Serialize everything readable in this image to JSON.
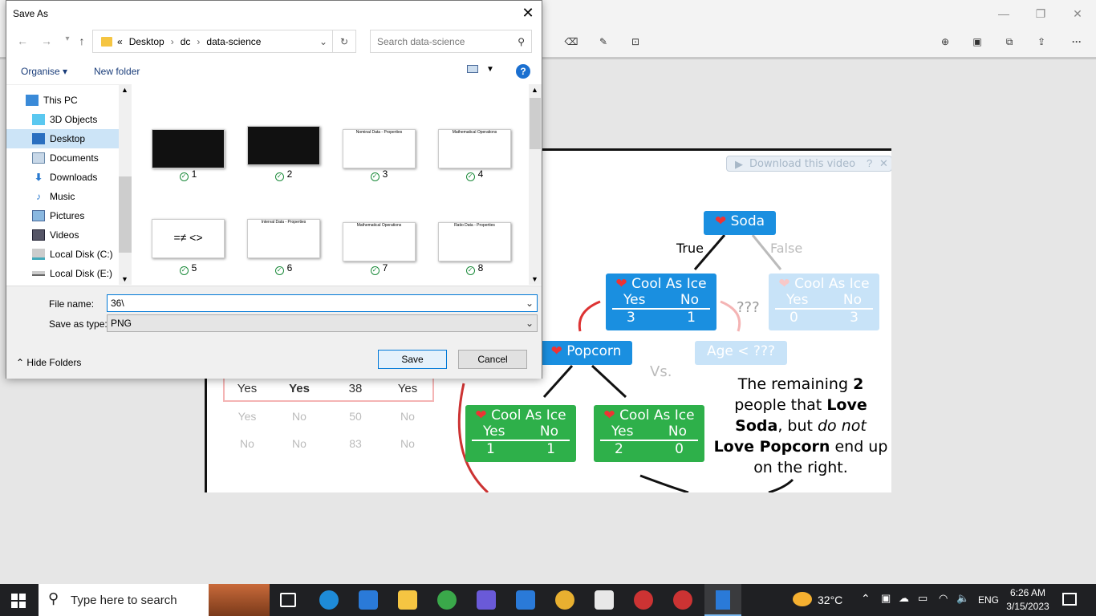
{
  "app": {
    "toolbar_icons": [
      "erase-icon",
      "ruler-icon",
      "crop-icon",
      "zoom-in-icon",
      "save-icon",
      "copy-icon",
      "share-icon",
      "more-icon"
    ]
  },
  "video": {
    "download_label": "Download this video",
    "table_rows": [
      [
        "Yes",
        "Yes",
        "38",
        "Yes"
      ],
      [
        "Yes",
        "No",
        "50",
        "No"
      ],
      [
        "No",
        "No",
        "83",
        "No"
      ]
    ],
    "soda": "Soda",
    "true_label": "True",
    "false_label": "False",
    "cool_as_ice": "Cool As Ice",
    "yes": "Yes",
    "no": "No",
    "left_vals": [
      "3",
      "1"
    ],
    "right_vals": [
      "0",
      "3"
    ],
    "qmarks": "???",
    "popcorn": "Popcorn",
    "age": "Age < ???",
    "vs": "Vs.",
    "bl_vals": [
      "1",
      "1"
    ],
    "br_vals": [
      "2",
      "0"
    ],
    "caption_parts": [
      "The remaining ",
      "2",
      " people that ",
      "Love Soda",
      ", but ",
      "do not",
      "Love Popcorn",
      " end up on the right."
    ]
  },
  "dialog": {
    "title": "Save As",
    "breadcrumb": [
      "«",
      "Desktop",
      "dc",
      "data-science"
    ],
    "search_placeholder": "Search data-science",
    "organise": "Organise",
    "new_folder": "New folder",
    "nav_items": [
      "This PC",
      "3D Objects",
      "Desktop",
      "Documents",
      "Downloads",
      "Music",
      "Pictures",
      "Videos",
      "Local Disk (C:)",
      "Local Disk (E:)"
    ],
    "thumb_headers": [
      "",
      "",
      "Nominal Data - Properties",
      "Mathematical Operations",
      "",
      "Interval Data - Properties",
      "Mathematical Operations",
      "Ratio Data - Properties"
    ],
    "files": [
      "1",
      "2",
      "3",
      "4",
      "5",
      "6",
      "7",
      "8"
    ],
    "file_name_label": "File name:",
    "file_name_value": "36\\",
    "save_type_label": "Save as type:",
    "save_type_value": "PNG",
    "hide_folders": "Hide Folders",
    "save_btn": "Save",
    "cancel_btn": "Cancel"
  },
  "taskbar": {
    "search_placeholder": "Type here to search",
    "temperature": "32°C",
    "language": "ENG",
    "time": "6:26 AM",
    "date": "3/15/2023"
  }
}
